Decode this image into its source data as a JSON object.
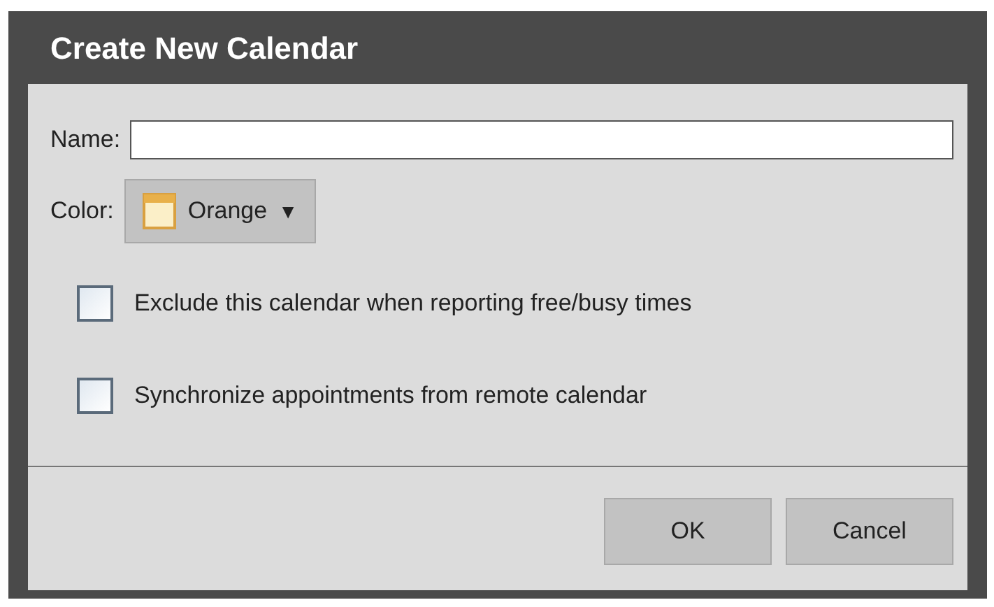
{
  "window": {
    "title": "Create New Calendar"
  },
  "name_field": {
    "label": "Name:"
  },
  "color_picker": {
    "label": "Color:",
    "value": "Orange",
    "caret": "▼"
  },
  "options": [
    {
      "label": "Exclude this calendar when reporting free/busy times",
      "checked": false
    },
    {
      "label": "Synchronize appointments from remote calendar",
      "checked": false
    }
  ],
  "buttons": [
    "OK",
    "Cancel"
  ]
}
